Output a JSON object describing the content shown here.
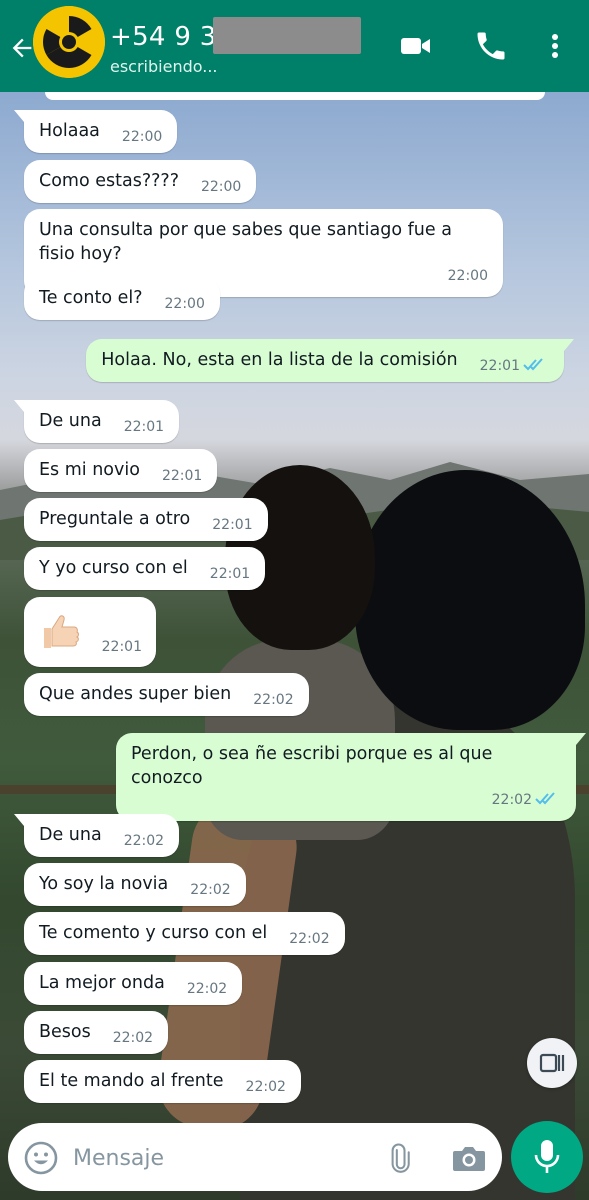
{
  "header": {
    "contact_name": "+54 9 35",
    "status": "escribiendo..."
  },
  "messages": [
    {
      "dir": "in",
      "text": "Holaaa",
      "time": "22:00"
    },
    {
      "dir": "in",
      "text": "Como estas????",
      "time": "22:00"
    },
    {
      "dir": "in",
      "text": "Una consulta por que sabes que santiago fue a fisio hoy?",
      "time": "22:00"
    },
    {
      "dir": "in",
      "text": "Te conto el?",
      "time": "22:00"
    },
    {
      "dir": "out",
      "text": "Holaa. No, esta en la lista de la comisión",
      "time": "22:01",
      "status": "read"
    },
    {
      "dir": "in",
      "text": "De una",
      "time": "22:01"
    },
    {
      "dir": "in",
      "text": "Es mi novio",
      "time": "22:01"
    },
    {
      "dir": "in",
      "text": "Preguntale a otro",
      "time": "22:01"
    },
    {
      "dir": "in",
      "text": "Y yo curso con el",
      "time": "22:01"
    },
    {
      "dir": "in",
      "text": "👍🏻",
      "emoji": "thumbs-up",
      "time": "22:01"
    },
    {
      "dir": "in",
      "text": "Que andes super bien",
      "time": "22:02"
    },
    {
      "dir": "out",
      "text": "Perdon, o sea ñe escribi porque es al que conozco",
      "time": "22:02",
      "status": "read"
    },
    {
      "dir": "in",
      "text": "De una",
      "time": "22:02"
    },
    {
      "dir": "in",
      "text": "Yo soy la novia",
      "time": "22:02"
    },
    {
      "dir": "in",
      "text": "Te comento y curso con el",
      "time": "22:02"
    },
    {
      "dir": "in",
      "text": "La mejor onda",
      "time": "22:02"
    },
    {
      "dir": "in",
      "text": "Besos",
      "time": "22:02"
    },
    {
      "dir": "in",
      "text": "El te mando al frente",
      "time": "22:02"
    }
  ],
  "composer": {
    "placeholder": "Mensaje"
  },
  "icons": {
    "back": "back-arrow-icon",
    "avatar": "radiation-symbol",
    "video": "video-call-icon",
    "call": "phone-icon",
    "menu": "more-vert-icon",
    "emoji": "emoji-icon",
    "attach": "paperclip-icon",
    "camera": "camera-icon",
    "mic": "microphone-icon",
    "pager": "page-scroll-icon",
    "read_receipt": "double-check-icon"
  },
  "colors": {
    "header": "#008069",
    "incoming_bubble": "#ffffff",
    "outgoing_bubble": "#d9fdd3",
    "read_check": "#53bdeb",
    "mic_button": "#00a884"
  }
}
